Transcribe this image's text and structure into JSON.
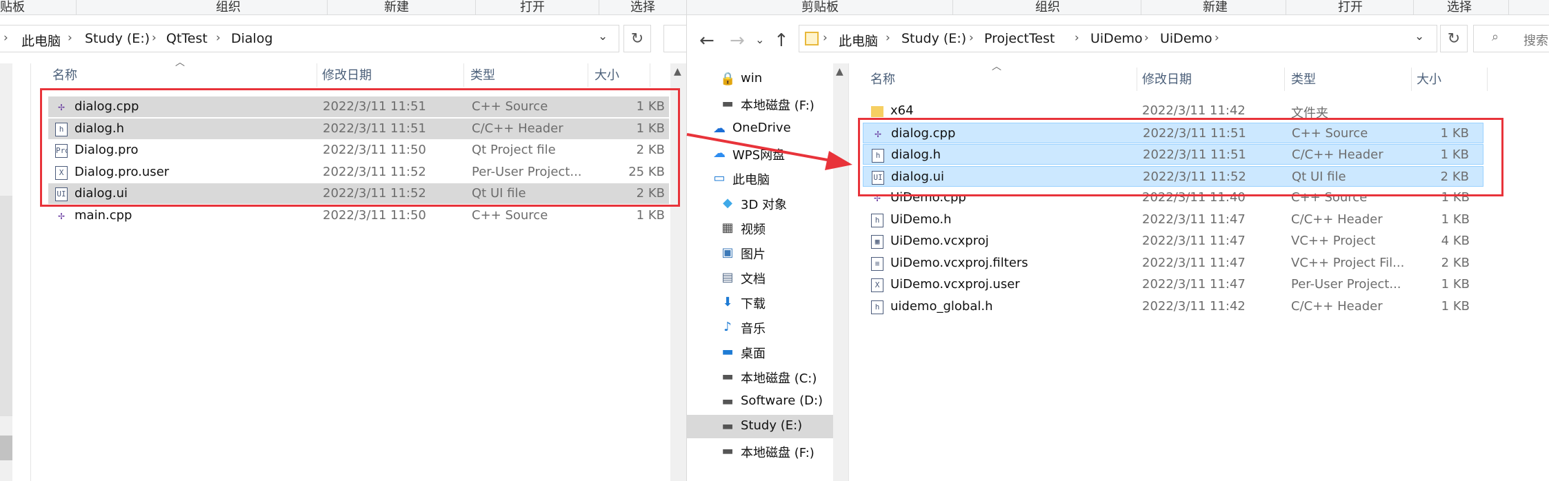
{
  "left": {
    "ribbon": [
      "贴板",
      "组织",
      "新建",
      "打开",
      "选择"
    ],
    "breadcrumb": [
      "此电脑",
      "Study (E:)",
      "QtTest",
      "Dialog"
    ],
    "headers": {
      "name": "名称",
      "date": "修改日期",
      "type": "类型",
      "size": "大小"
    },
    "files": [
      {
        "name": "dialog.cpp",
        "date": "2022/3/11 11:51",
        "type": "C++ Source",
        "size": "1 KB",
        "icon": "cpp-source-icon",
        "glyph": "✢",
        "selected": true
      },
      {
        "name": "dialog.h",
        "date": "2022/3/11 11:51",
        "type": "C/C++ Header",
        "size": "1 KB",
        "icon": "header-file-icon",
        "glyph": "h",
        "selected": true
      },
      {
        "name": "Dialog.pro",
        "date": "2022/3/11 11:50",
        "type": "Qt Project file",
        "size": "2 KB",
        "icon": "qt-project-icon",
        "glyph": "Pro",
        "selected": false
      },
      {
        "name": "Dialog.pro.user",
        "date": "2022/3/11 11:52",
        "type": "Per-User Project...",
        "size": "25 KB",
        "icon": "vs-user-file-icon",
        "glyph": "X",
        "selected": false
      },
      {
        "name": "dialog.ui",
        "date": "2022/3/11 11:52",
        "type": "Qt UI file",
        "size": "2 KB",
        "icon": "ui-file-icon",
        "glyph": "UI",
        "selected": true
      },
      {
        "name": "main.cpp",
        "date": "2022/3/11 11:50",
        "type": "C++ Source",
        "size": "1 KB",
        "icon": "cpp-source-icon",
        "glyph": "✢",
        "selected": false
      }
    ]
  },
  "right": {
    "ribbon": [
      "剪贴板",
      "组织",
      "新建",
      "打开",
      "选择"
    ],
    "breadcrumb": [
      "此电脑",
      "Study (E:)",
      "ProjectTest",
      "UiDemo",
      "UiDemo"
    ],
    "search_placeholder": "搜索",
    "headers": {
      "name": "名称",
      "date": "修改日期",
      "type": "类型",
      "size": "大小"
    },
    "nav": [
      {
        "label": "win",
        "icon": "user-folder-icon",
        "glyph": "🔒",
        "color": "#e8a33a",
        "indent": 2,
        "selected": false
      },
      {
        "label": "本地磁盘 (F:)",
        "icon": "drive-icon",
        "glyph": "▬",
        "color": "#555555",
        "indent": 2,
        "selected": false
      },
      {
        "label": "OneDrive",
        "icon": "onedrive-icon",
        "glyph": "☁",
        "color": "#1b6ed6",
        "indent": 1,
        "selected": false
      },
      {
        "label": "WPS网盘",
        "icon": "wps-cloud-icon",
        "glyph": "☁",
        "color": "#2d8cf0",
        "indent": 1,
        "selected": false
      },
      {
        "label": "此电脑",
        "icon": "this-pc-icon",
        "glyph": "▭",
        "color": "#1e7bd4",
        "indent": 1,
        "selected": false
      },
      {
        "label": "3D 对象",
        "icon": "3d-objects-icon",
        "glyph": "◆",
        "color": "#3fa9e8",
        "indent": 2,
        "selected": false
      },
      {
        "label": "视频",
        "icon": "video-icon",
        "glyph": "▦",
        "color": "#444444",
        "indent": 2,
        "selected": false
      },
      {
        "label": "图片",
        "icon": "pictures-icon",
        "glyph": "▣",
        "color": "#3d7ab8",
        "indent": 2,
        "selected": false
      },
      {
        "label": "文档",
        "icon": "documents-icon",
        "glyph": "▤",
        "color": "#5a6f8c",
        "indent": 2,
        "selected": false
      },
      {
        "label": "下载",
        "icon": "downloads-icon",
        "glyph": "⬇",
        "color": "#1e7bd4",
        "indent": 2,
        "selected": false
      },
      {
        "label": "音乐",
        "icon": "music-icon",
        "glyph": "♪",
        "color": "#1e7bd4",
        "indent": 2,
        "selected": false
      },
      {
        "label": "桌面",
        "icon": "desktop-icon",
        "glyph": "▬",
        "color": "#1e7bd4",
        "indent": 2,
        "selected": false
      },
      {
        "label": "本地磁盘 (C:)",
        "icon": "drive-c-icon",
        "glyph": "▬",
        "color": "#555555",
        "indent": 2,
        "selected": false
      },
      {
        "label": "Software (D:)",
        "icon": "drive-d-icon",
        "glyph": "▬",
        "color": "#555555",
        "indent": 2,
        "selected": false
      },
      {
        "label": "Study (E:)",
        "icon": "drive-e-icon",
        "glyph": "▬",
        "color": "#555555",
        "indent": 2,
        "selected": true
      },
      {
        "label": "本地磁盘 (F:)",
        "icon": "drive-f-icon",
        "glyph": "▬",
        "color": "#555555",
        "indent": 2,
        "selected": false
      }
    ],
    "files": [
      {
        "name": "x64",
        "date": "2022/3/11 11:42",
        "type": "文件夹",
        "size": "",
        "icon": "folder-icon",
        "glyph": "",
        "selected": false
      },
      {
        "name": "dialog.cpp",
        "date": "2022/3/11 11:51",
        "type": "C++ Source",
        "size": "1 KB",
        "icon": "cpp-source-icon",
        "glyph": "✢",
        "selected": true
      },
      {
        "name": "dialog.h",
        "date": "2022/3/11 11:51",
        "type": "C/C++ Header",
        "size": "1 KB",
        "icon": "header-file-icon",
        "glyph": "h",
        "selected": true
      },
      {
        "name": "dialog.ui",
        "date": "2022/3/11 11:52",
        "type": "Qt UI file",
        "size": "2 KB",
        "icon": "ui-file-icon",
        "glyph": "UI",
        "selected": true
      },
      {
        "name": "UiDemo.cpp",
        "date": "2022/3/11 11:40",
        "type": "C++ Source",
        "size": "1 KB",
        "icon": "cpp-source-icon",
        "glyph": "✢",
        "selected": false
      },
      {
        "name": "UiDemo.h",
        "date": "2022/3/11 11:47",
        "type": "C/C++ Header",
        "size": "1 KB",
        "icon": "header-file-icon",
        "glyph": "h",
        "selected": false
      },
      {
        "name": "UiDemo.vcxproj",
        "date": "2022/3/11 11:47",
        "type": "VC++ Project",
        "size": "4 KB",
        "icon": "vcxproj-icon",
        "glyph": "▦",
        "selected": false
      },
      {
        "name": "UiDemo.vcxproj.filters",
        "date": "2022/3/11 11:47",
        "type": "VC++ Project Fil...",
        "size": "2 KB",
        "icon": "filters-file-icon",
        "glyph": "≡",
        "selected": false
      },
      {
        "name": "UiDemo.vcxproj.user",
        "date": "2022/3/11 11:47",
        "type": "Per-User Project...",
        "size": "1 KB",
        "icon": "vs-user-file-icon",
        "glyph": "X",
        "selected": false
      },
      {
        "name": "uidemo_global.h",
        "date": "2022/3/11 11:42",
        "type": "C/C++ Header",
        "size": "1 KB",
        "icon": "header-file-icon",
        "glyph": "h",
        "selected": false
      }
    ]
  },
  "colors": {
    "highlight": "#e8333a",
    "selection_blue": "#cce8ff",
    "selection_gray": "#d9d9d9"
  }
}
